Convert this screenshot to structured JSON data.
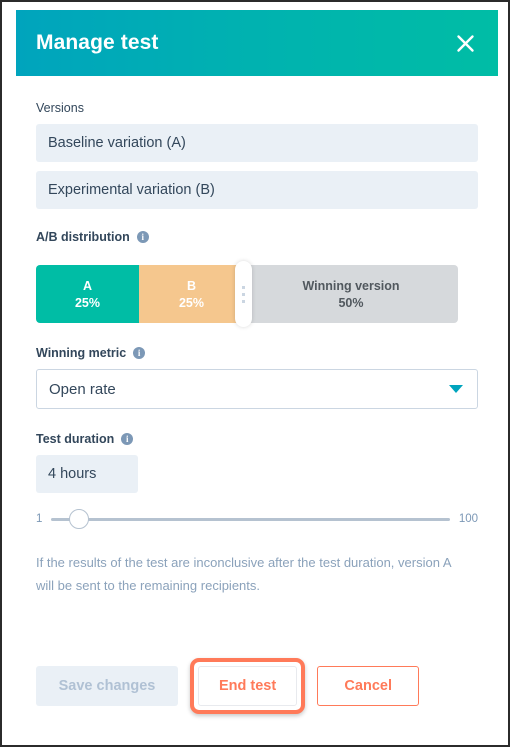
{
  "modal": {
    "title": "Manage test",
    "close_icon": "close-icon"
  },
  "versions": {
    "label": "Versions",
    "items": [
      {
        "value": "Baseline variation (A)"
      },
      {
        "value": "Experimental variation (B)"
      }
    ]
  },
  "distribution": {
    "label": "A/B distribution",
    "info_icon": "info-icon",
    "segments": [
      {
        "name": "A",
        "percent": "25%",
        "value": 25,
        "color": "#00BDA5"
      },
      {
        "name": "B",
        "percent": "25%",
        "value": 25,
        "color": "#F5C78E"
      },
      {
        "name": "Winning version",
        "percent": "50%",
        "value": 50,
        "color": "#D6D9DC"
      }
    ],
    "handle_icon": "drag-handle-icon"
  },
  "winning_metric": {
    "label": "Winning metric",
    "info_icon": "info-icon",
    "selected": "Open rate",
    "caret_icon": "chevron-down-icon"
  },
  "test_duration": {
    "label": "Test duration",
    "info_icon": "info-icon",
    "value": "4 hours",
    "slider": {
      "min_label": "1",
      "max_label": "100",
      "min": 1,
      "max": 100,
      "value": 4
    }
  },
  "helper_text": "If the results of the test are inconclusive after the test duration, version A will be sent to the remaining recipients.",
  "footer": {
    "save_label": "Save changes",
    "end_test_label": "End test",
    "cancel_label": "Cancel"
  },
  "colors": {
    "header_gradient_start": "#00A4BD",
    "header_gradient_end": "#00BDA5",
    "accent_orange": "#FF7A59",
    "input_bg": "#EAF0F6",
    "text_dark": "#33475B",
    "text_muted": "#8BA2BB"
  }
}
